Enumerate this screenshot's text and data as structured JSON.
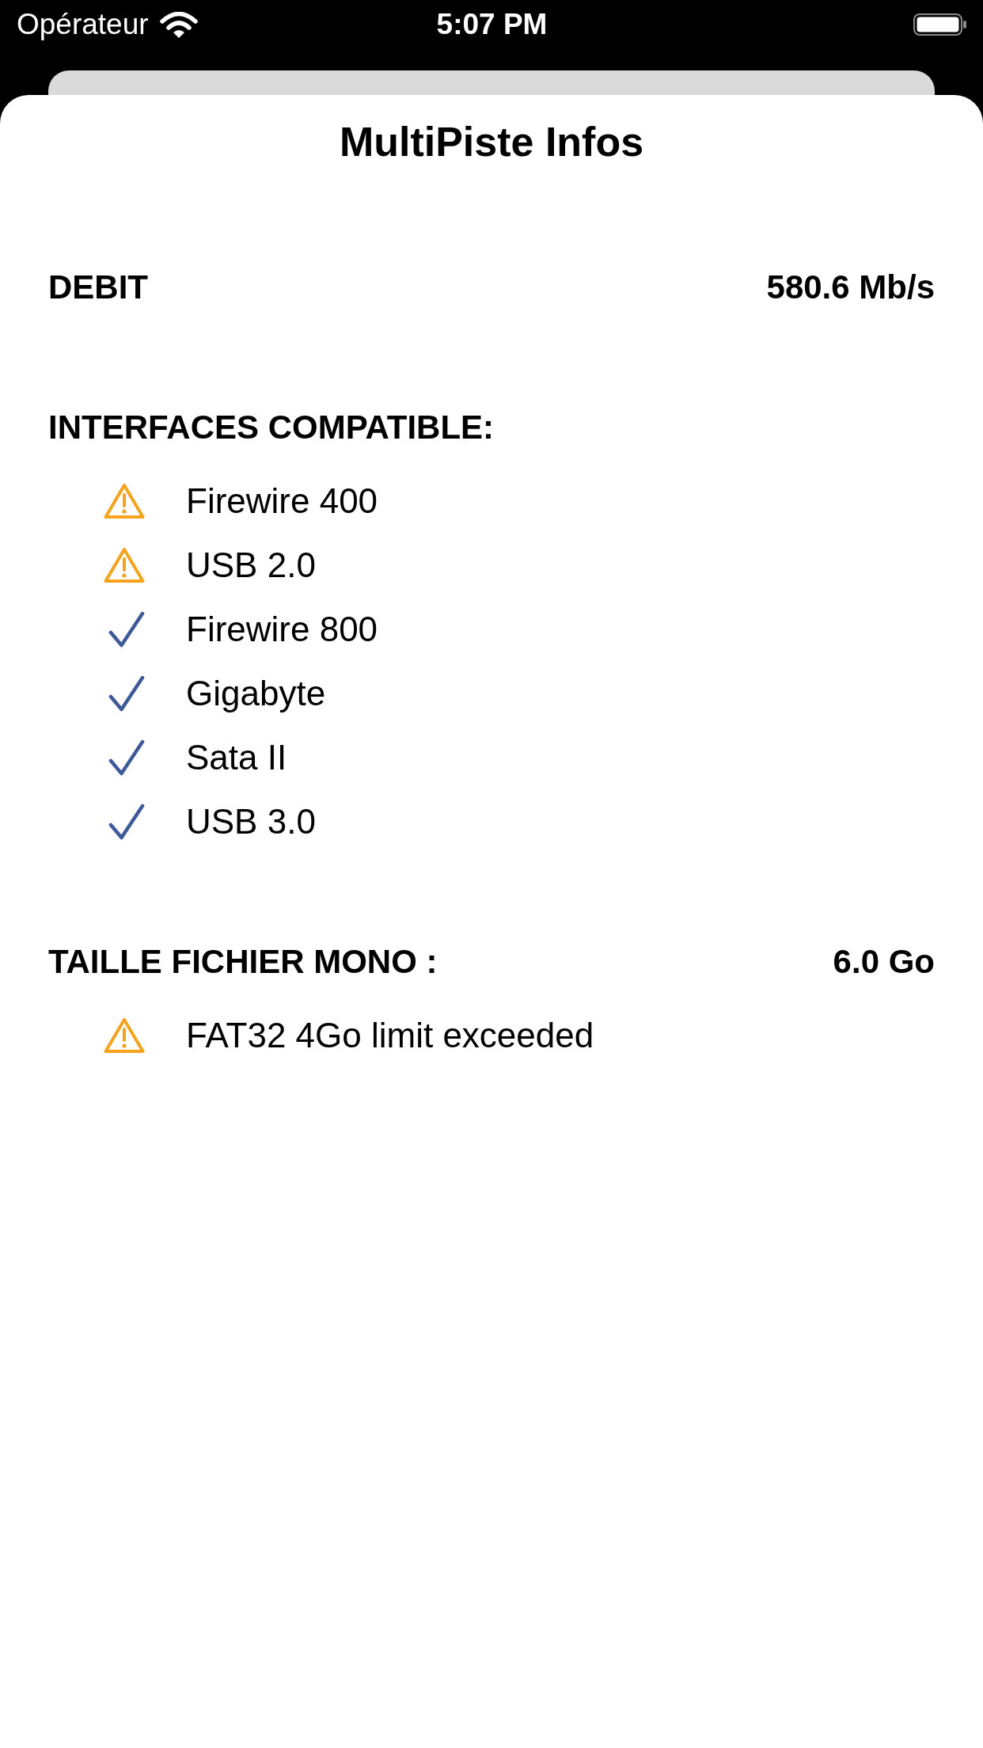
{
  "status_bar": {
    "carrier": "Opérateur",
    "time": "5:07 PM"
  },
  "sheet": {
    "title": "MultiPiste Infos"
  },
  "sections": [
    {
      "label": "DEBIT",
      "value": "580.6 Mb/s"
    },
    {
      "label": "INTERFACES COMPATIBLE:",
      "items": [
        {
          "label": "Firewire 400",
          "kind": "warning"
        },
        {
          "label": "USB 2.0",
          "kind": "warning"
        },
        {
          "label": "Firewire 800",
          "kind": "ok"
        },
        {
          "label": "Gigabyte",
          "kind": "ok"
        },
        {
          "label": "Sata II",
          "kind": "ok"
        },
        {
          "label": "USB 3.0",
          "kind": "ok"
        }
      ]
    },
    {
      "label": "TAILLE FICHIER MONO :",
      "value": "6.0 Go",
      "items": [
        {
          "label": "FAT32 4Go limit exceeded",
          "kind": "warning"
        }
      ]
    }
  ]
}
